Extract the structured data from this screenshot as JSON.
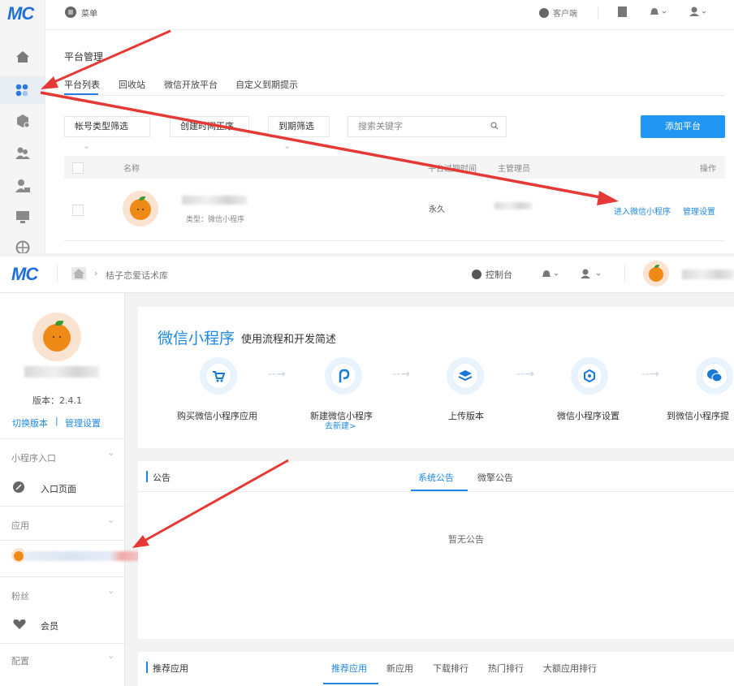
{
  "top": {
    "logo": "MC",
    "menu_label": "菜单",
    "client_label": "客户端",
    "tabs_header": "平台管理",
    "tabs": [
      "平台列表",
      "回收站",
      "微信开放平台",
      "自定义到期提示"
    ],
    "filters": {
      "account_type": "帐号类型筛选",
      "create_time": "创建时间正序",
      "expire": "到期筛选",
      "search_placeholder": "搜索关键字"
    },
    "add_button": "添加平台",
    "table": {
      "col_name": "名称",
      "col_expire": "平台过期时间",
      "col_admin": "主管理员",
      "col_ops": "操作",
      "row": {
        "type": "类型：微信小程序",
        "expire": "永久",
        "enter_link": "进入微信小程序",
        "manage_link": "管理设置"
      }
    }
  },
  "bottom": {
    "logo": "MC",
    "breadcrumb": "桔子恋爱话术库",
    "console": "控制台",
    "sidebar": {
      "version": "版本：2.4.1",
      "switch_version": "切换版本",
      "manage": "管理设置",
      "sections": {
        "mini_entry": "小程序入口",
        "entry_page": "入口页面",
        "apps": "应用",
        "fans": "粉丝",
        "member": "会员",
        "config": "配置"
      }
    },
    "flow": {
      "title_main": "微信小程序",
      "title_sub": "使用流程和开发简述",
      "steps": [
        {
          "label": "购买微信小程序应用",
          "icon": "cart-icon"
        },
        {
          "label": "新建微信小程序",
          "link": "去新建>",
          "icon": "link-icon"
        },
        {
          "label": "上传版本",
          "icon": "layers-icon"
        },
        {
          "label": "微信小程序设置",
          "icon": "settings-icon"
        },
        {
          "label": "到微信小程序提",
          "icon": "wechat-icon"
        }
      ]
    },
    "notice": {
      "title": "公告",
      "tabs": [
        "系统公告",
        "微擎公告"
      ],
      "empty": "暂无公告"
    },
    "recommend": {
      "title": "推荐应用",
      "tabs": [
        "推荐应用",
        "新应用",
        "下载排行",
        "热门排行",
        "大额应用排行"
      ]
    }
  }
}
